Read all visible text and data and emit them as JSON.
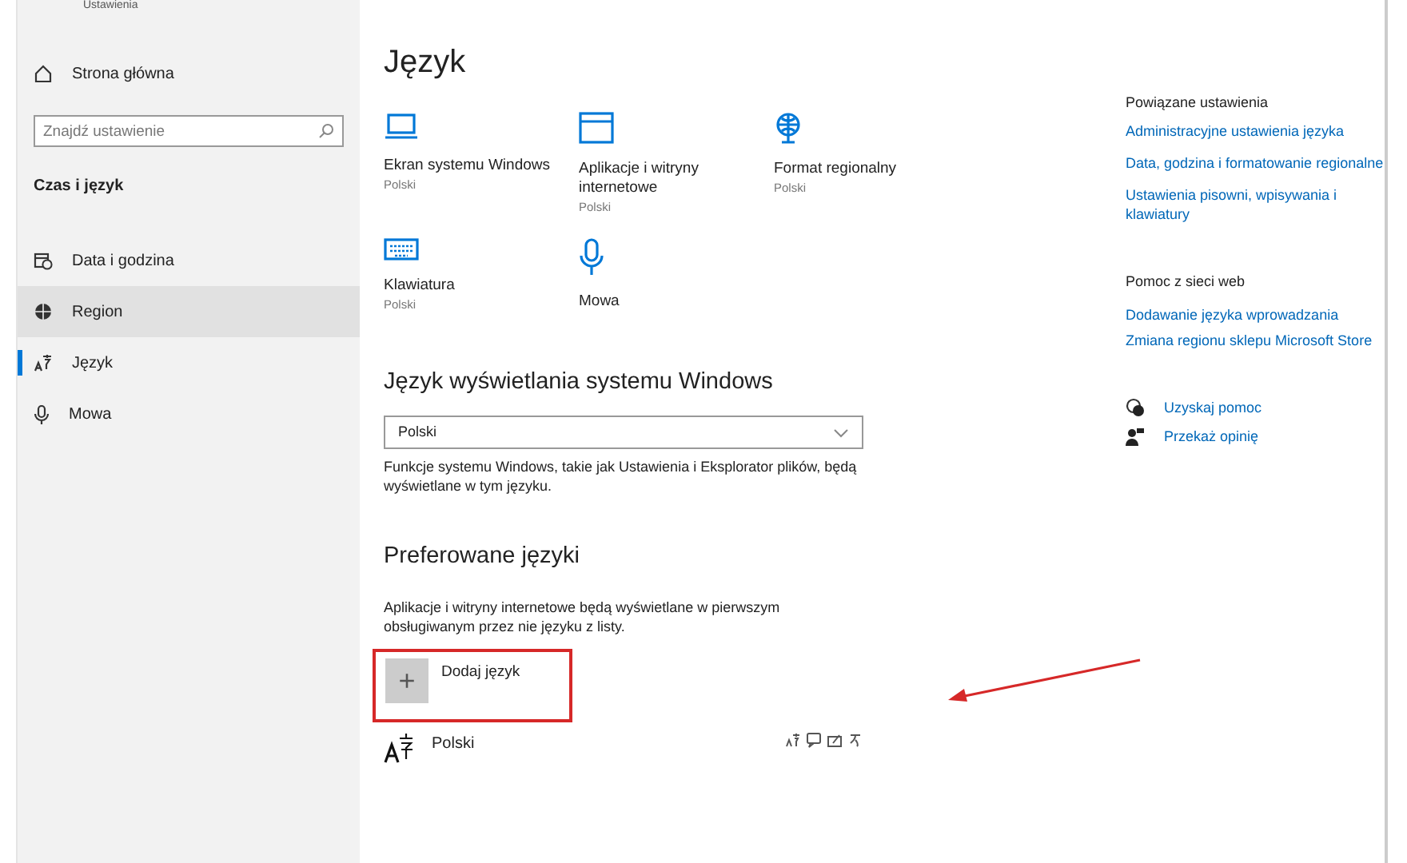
{
  "app_title": "Ustawienia",
  "sidebar": {
    "home": "Strona główna",
    "search": {
      "placeholder": "Znajdź ustawienie"
    },
    "section": "Czas i język",
    "items": [
      {
        "label": "Data i godzina",
        "selected": false,
        "hovered": false
      },
      {
        "label": "Region",
        "selected": false,
        "hovered": true
      },
      {
        "label": "Język",
        "selected": true,
        "hovered": false
      },
      {
        "label": "Mowa",
        "selected": false,
        "hovered": false
      }
    ]
  },
  "page_title": "Język",
  "tiles": [
    {
      "title": "Ekran systemu Windows",
      "subtitle": "Polski"
    },
    {
      "title": "Aplikacje i witryny internetowe",
      "subtitle": "Polski"
    },
    {
      "title": "Format regionalny",
      "subtitle": "Polski"
    },
    {
      "title": "Klawiatura",
      "subtitle": "Polski"
    },
    {
      "title": "Mowa"
    }
  ],
  "display_language": {
    "heading": "Język wyświetlania systemu Windows",
    "value": "Polski",
    "description": "Funkcje systemu Windows, takie jak Ustawienia i Eksplorator plików, będą wyświetlane w tym języku."
  },
  "preferred": {
    "heading": "Preferowane języki",
    "description": "Aplikacje i witryny internetowe będą wyświetlane w pierwszym obsługiwanym przez nie języku z listy.",
    "add_button": "Dodaj język",
    "add_icon": "+",
    "highlighted": true,
    "languages": [
      {
        "name": "Polski"
      }
    ]
  },
  "related": {
    "heading": "Powiązane ustawienia",
    "links": [
      "Administracyjne ustawienia języka",
      "Data, godzina i formatowanie regionalne",
      "Ustawienia pisowni, wpisywania i klawiatury"
    ]
  },
  "web_help": {
    "heading": "Pomoc z sieci web",
    "links": [
      "Dodawanie języka wprowadzania",
      "Zmiana regionu sklepu Microsoft Store"
    ]
  },
  "actions": [
    "Uzyskaj pomoc",
    "Przekaż opinię"
  ]
}
